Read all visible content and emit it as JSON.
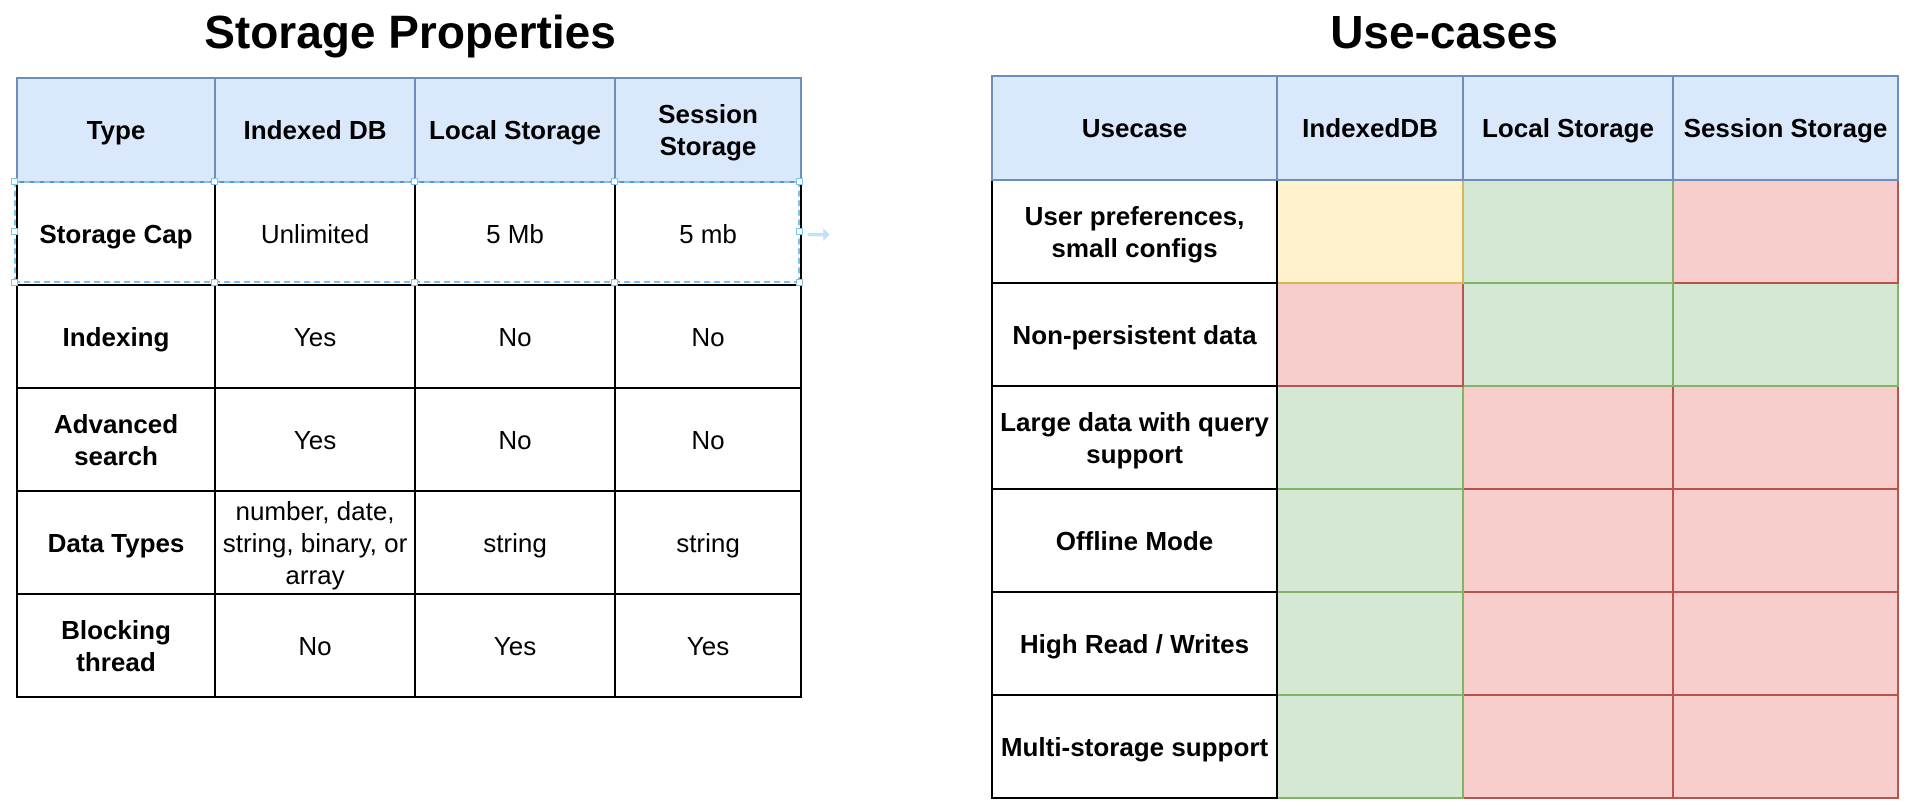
{
  "properties": {
    "title": "Storage Properties",
    "headers": [
      "Type",
      "Indexed DB",
      "Local Storage",
      "Session Storage"
    ],
    "rows": [
      {
        "label": "Storage Cap",
        "values": [
          "Unlimited",
          "5 Mb",
          "5 mb"
        ]
      },
      {
        "label": "Indexing",
        "values": [
          "Yes",
          "No",
          "No"
        ]
      },
      {
        "label": "Advanced search",
        "values": [
          "Yes",
          "No",
          "No"
        ]
      },
      {
        "label": "Data Types",
        "values": [
          "number, date, string, binary, or array",
          "string",
          "string"
        ]
      },
      {
        "label": "Blocking thread",
        "values": [
          "No",
          "Yes",
          "Yes"
        ]
      }
    ]
  },
  "usecases": {
    "title": "Use-cases",
    "headers": [
      "Usecase",
      "IndexedDB",
      "Local Storage",
      "Session Storage"
    ],
    "colors": {
      "green": "#d5e8d4",
      "red": "#f8cecc",
      "yellow": "#fff2cc",
      "header": "#dae8fc"
    },
    "rows": [
      {
        "label": "User preferences, small configs",
        "ratings": [
          "yellow",
          "green",
          "red"
        ]
      },
      {
        "label": "Non-persistent data",
        "ratings": [
          "red",
          "green",
          "green"
        ]
      },
      {
        "label": "Large data with query support",
        "ratings": [
          "green",
          "red",
          "red"
        ]
      },
      {
        "label": "Offline Mode",
        "ratings": [
          "green",
          "red",
          "red"
        ]
      },
      {
        "label": "High Read / Writes",
        "ratings": [
          "green",
          "red",
          "red"
        ]
      },
      {
        "label": "Multi-storage support",
        "ratings": [
          "green",
          "red",
          "red"
        ]
      }
    ]
  }
}
